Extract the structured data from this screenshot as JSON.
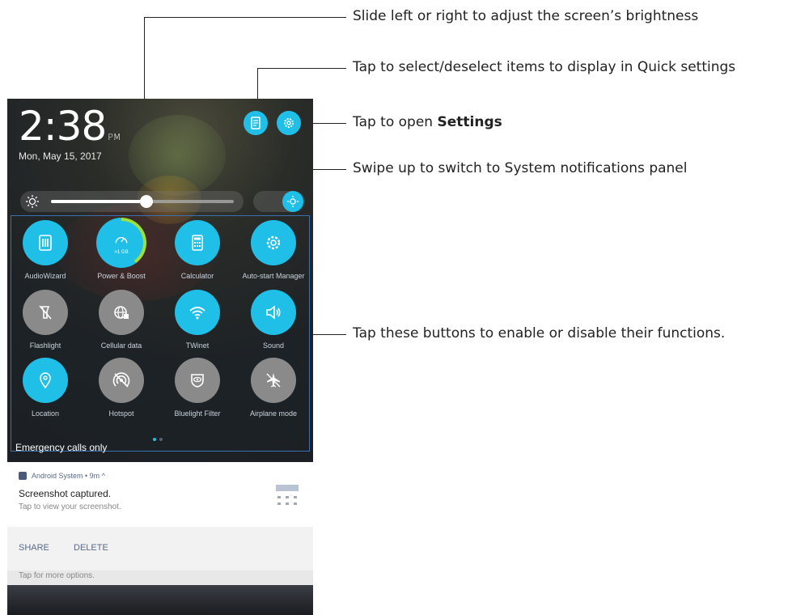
{
  "status": {
    "time": "2:38",
    "ampm": "PM",
    "date": "Mon, May 15, 2017"
  },
  "brightness": {
    "level": 0.52,
    "auto_enabled": true
  },
  "quick_settings": [
    {
      "label": "AudioWizard",
      "state": "on",
      "icon": "equalizer-icon"
    },
    {
      "label": "Power & Boost",
      "state": "on",
      "icon": "speedometer-icon",
      "sub": ">1 GB"
    },
    {
      "label": "Calculator",
      "state": "on",
      "icon": "calculator-icon"
    },
    {
      "label": "Auto-start Manager",
      "state": "on",
      "icon": "gear-icon"
    },
    {
      "label": "Flashlight",
      "state": "off",
      "icon": "flashlight-icon"
    },
    {
      "label": "Cellular data",
      "state": "off",
      "icon": "cellular-data-icon"
    },
    {
      "label": "TWinet",
      "state": "on",
      "icon": "wifi-icon"
    },
    {
      "label": "Sound",
      "state": "on",
      "icon": "speaker-icon"
    },
    {
      "label": "Location",
      "state": "on",
      "icon": "location-pin-icon"
    },
    {
      "label": "Hotspot",
      "state": "off",
      "icon": "hotspot-icon"
    },
    {
      "label": "Bluelight Filter",
      "state": "off",
      "icon": "bluelight-filter-icon"
    },
    {
      "label": "Airplane mode",
      "state": "off",
      "icon": "airplane-icon"
    }
  ],
  "emergency_text": "Emergency calls only",
  "notification": {
    "app": "Android System • 9m ^",
    "title": "Screenshot captured.",
    "subtitle": "Tap to view your screenshot.",
    "actions": [
      "SHARE",
      "DELETE"
    ],
    "more": "Tap for more options."
  },
  "annotations": {
    "brightness": "Slide left or right to adjust the screen’s brightness",
    "quick_edit": "Tap to select/deselect items to display in Quick settings",
    "settings_prefix": "Tap to open ",
    "settings_bold": "Settings",
    "swipe": "Swipe up to switch to System notifications panel",
    "buttons": "Tap these buttons to enable or disable their functions."
  },
  "colors": {
    "accent": "#1fbfe8",
    "off": "#8a8a8a",
    "boost_ring": "#9be03c"
  }
}
